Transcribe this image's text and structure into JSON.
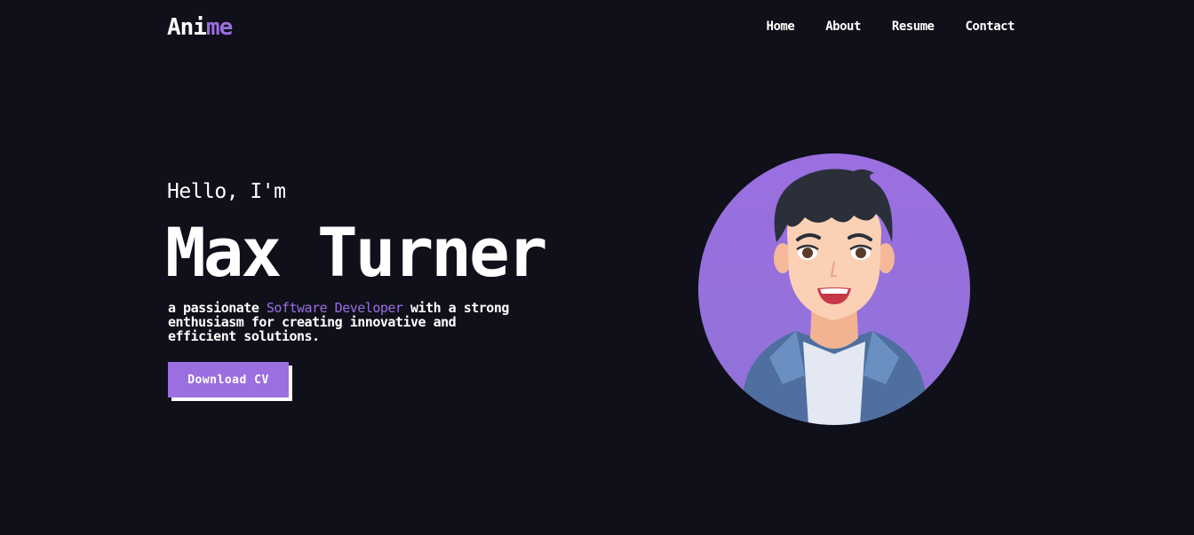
{
  "brand": {
    "logo_part1": "Ani",
    "logo_part2": "me"
  },
  "nav": {
    "home": "Home",
    "about": "About",
    "resume": "Resume",
    "contact": "Contact"
  },
  "hero": {
    "greeting": "Hello, I'm",
    "name": "Max Turner",
    "tagline_pre": "a passionate ",
    "tagline_highlight": "Software Developer",
    "tagline_post": " with a strong enthusiasm for creating innovative and efficient solutions.",
    "cta_label": "Download CV"
  },
  "colors": {
    "background": "#0f101a",
    "accent": "#9b6fe0",
    "text": "#ffffff"
  },
  "icons": {
    "avatar": "cartoon-developer-avatar"
  }
}
